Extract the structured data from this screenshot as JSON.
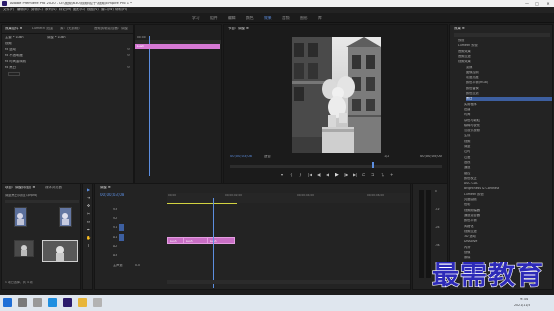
{
  "window": {
    "title": "Adobe Premiere Pro 2020 - D:\\视频\\630\\视频\\粒子\\视频\\Empire Pro 1 *",
    "minimize": "—",
    "maximize": "□",
    "close": "✕"
  },
  "menu": [
    "文件(F)",
    "编辑(E)",
    "剪辑(C)",
    "序列(S)",
    "标记(M)",
    "图形(G)",
    "视图(V)",
    "窗口(W)",
    "帮助(H)"
  ],
  "workspaces": {
    "items": [
      "学习",
      "组件",
      "编辑",
      "颜色",
      "效果",
      "音频",
      "图形",
      "库"
    ],
    "active_index": 4
  },
  "effect_controls": {
    "tabs": [
      "效果控件 ≡",
      "Lumetri 范围",
      "源：(无剪辑)",
      "音频剪辑混合器：调整"
    ],
    "source": "主要 * Lush",
    "sequence": "调整 * Lush",
    "time_start": "00:00",
    "rows": [
      "视频",
      "fx  运动",
      "fx  不透明度",
      "fx  时间重映射",
      "fx  黑白"
    ],
    "clip_label": "Lush"
  },
  "program_monitor": {
    "tab": "节目：调整 ≡",
    "timecode": "00;00;03;08",
    "fit": "适合",
    "scale": "1/2",
    "duration": "00;00;05;00",
    "controls": [
      "▾",
      "{",
      "}",
      "|◀",
      "◀|",
      "◀",
      "▶",
      "|▶",
      "▶|",
      "⊏",
      "⊐",
      "⤵",
      "+"
    ]
  },
  "project": {
    "tabs": [
      "项目：调整(项目) ≡",
      "媒体浏览器"
    ],
    "filename": "调整黑白(项目).prproj",
    "items_count": "1 项已选择，共 4 项"
  },
  "tools": [
    "▶",
    "⇥",
    "✥",
    "✂",
    "⇔",
    "✒",
    "✋",
    "T"
  ],
  "timeline": {
    "tab": "调整 ≡",
    "timecode": "00;00;03;08",
    "ruler": [
      "00;00",
      "00;00;02;00",
      "00;00;04;00",
      "00;00;06;00"
    ],
    "tracks": [
      "V3",
      "V2",
      "V1",
      "A1",
      "A2",
      "A3"
    ],
    "master": "主声道",
    "master_value": "0.0",
    "clips": [
      "Lush",
      "Lush",
      "Lush"
    ]
  },
  "meter": {
    "labels": [
      "0",
      "-12",
      "-24",
      "-36",
      "-48",
      "dB"
    ]
  },
  "effects_panel": {
    "title": "效果 ≡",
    "items": [
      "预设",
      "Lumetri 预设",
      "音频效果",
      "音频过渡",
      "视频效果",
      "变换",
      "图像控制",
      "灰度亮度",
      "颜色平衡(RGB)",
      "颜色替换",
      "颜色过滤",
      "黑白",
      "实用程序",
      "扭曲",
      "时间",
      "杂色与颗粒",
      "模糊与锐化",
      "沉浸式视频",
      "生成",
      "视频",
      "调整",
      "过时",
      "过渡",
      "透视",
      "通道",
      "键控",
      "颜色校正",
      "ASC CDL",
      "Brightness & Contrast",
      "Lumetri 颜色",
      "亮度曲线",
      "色彩",
      "视频限幅器",
      "通道混合器",
      "颜色平衡",
      "风格化",
      "视频过渡",
      "3D 运动",
      "Dissolve",
      "内滑",
      "划像",
      "擦除",
      "沉浸式视频",
      "缩放",
      "页面剥落"
    ]
  },
  "taskbar": {
    "time": "9:34",
    "date": "2021/11/5"
  },
  "watermark": "最需教育",
  "colors": {
    "accent": "#5c8ee0",
    "clip": "#c96fc5",
    "playhead": "#5c8ee0"
  }
}
